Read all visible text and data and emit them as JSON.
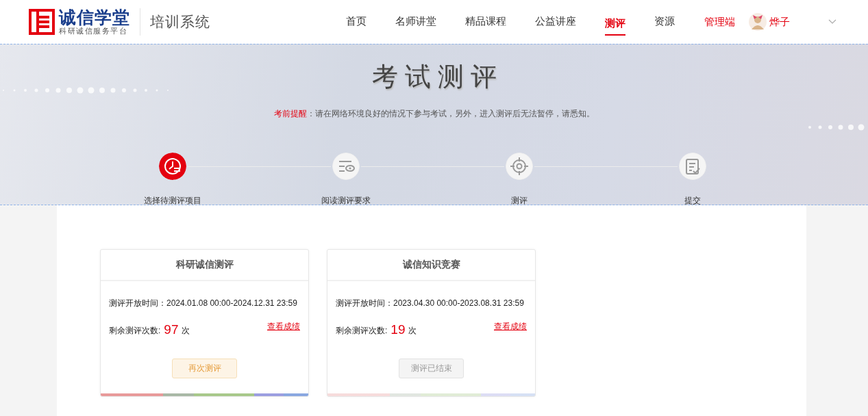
{
  "header": {
    "logo": {
      "name": "诚信学堂",
      "tagline": "科研诚信服务平台"
    },
    "system_title": "培训系统",
    "nav": [
      {
        "label": "首页",
        "selected": false
      },
      {
        "label": "名师讲堂",
        "selected": false
      },
      {
        "label": "精品课程",
        "selected": false
      },
      {
        "label": "公益讲座",
        "selected": false
      },
      {
        "label": "测评",
        "selected": true
      },
      {
        "label": "资源",
        "selected": false
      }
    ],
    "admin_link": "管理端",
    "user": {
      "name": "烨子"
    }
  },
  "banner": {
    "title": "考试测评",
    "notice": {
      "label": "考前提醒",
      "text": "：请在网络环境良好的情况下参与考试，另外，进入测评后无法暂停，请悉知。"
    }
  },
  "steps": [
    {
      "label": "选择待测评项目",
      "kind": "clock",
      "selected": true
    },
    {
      "label": "阅读测评要求",
      "kind": "read",
      "selected": false
    },
    {
      "label": "测评",
      "kind": "target",
      "selected": false
    },
    {
      "label": "提交",
      "kind": "submit",
      "selected": false
    }
  ],
  "cards": [
    {
      "title": "科研诚信测评",
      "period_label": "测评开放时间：",
      "period": "2024.01.08 00:00-2024.12.31 23:59",
      "remaining_label": "剩余测评次数:",
      "remaining": "97",
      "unit": "次",
      "link": "查看成绩",
      "button": {
        "label": "再次测评",
        "disabled": false
      }
    },
    {
      "title": "诚信知识竞赛",
      "period_label": "测评开放时间：",
      "period": "2023.04.30 00:00-2023.08.31 23:59",
      "remaining_label": "剩余测评次数:",
      "remaining": "19",
      "unit": "次",
      "link": "查看成绩",
      "button": {
        "label": "测评已结束",
        "disabled": true
      }
    }
  ]
}
